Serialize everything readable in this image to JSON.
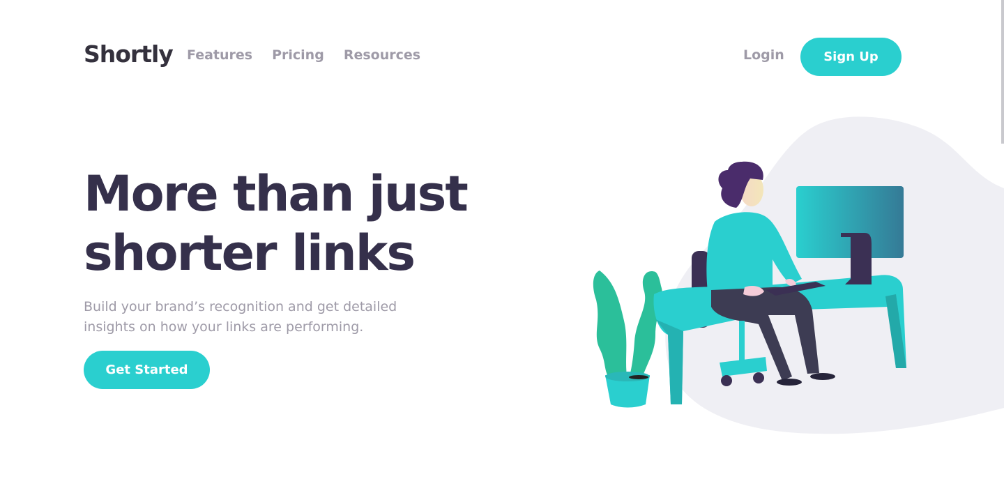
{
  "header": {
    "logo": "Shortly",
    "nav": [
      {
        "label": "Features"
      },
      {
        "label": "Pricing"
      },
      {
        "label": "Resources"
      }
    ],
    "login_label": "Login",
    "signup_label": "Sign Up"
  },
  "hero": {
    "title": "More than just shorter links",
    "subtitle": "Build your brand’s recognition and get detailed insights on how your links are performing.",
    "cta_label": "Get Started"
  },
  "colors": {
    "accent": "#2acfcf",
    "heading": "#35304b",
    "muted": "#9e9aa7",
    "illustration_bg": "#efeff4"
  },
  "illustration": {
    "icon": "person-working-at-desk-illustration"
  }
}
